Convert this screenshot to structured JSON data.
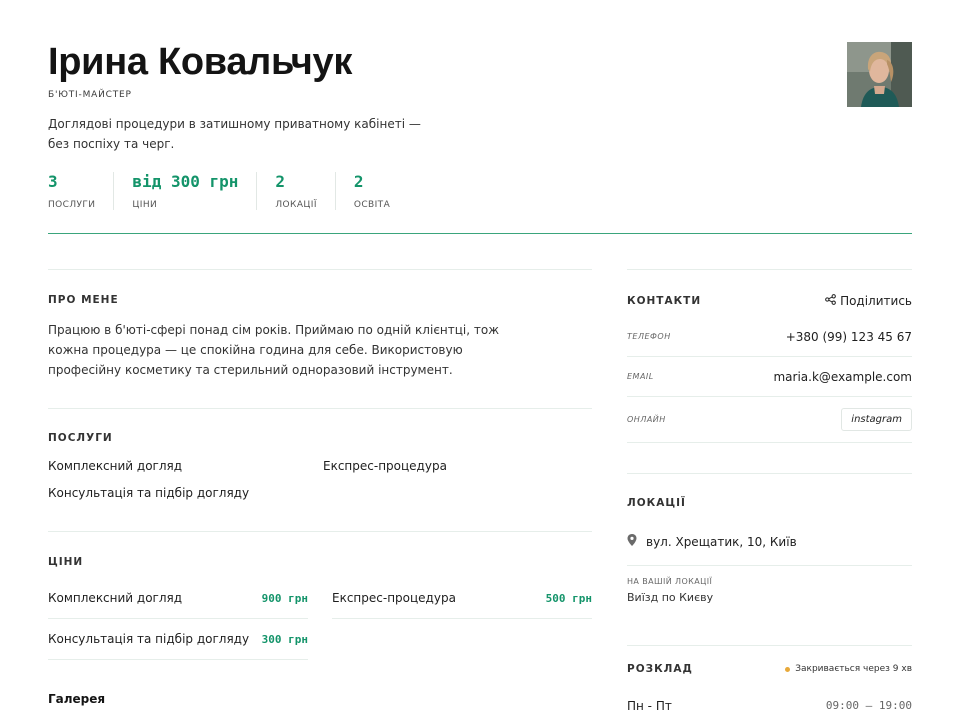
{
  "profile": {
    "name": "Ірина Ковальчук",
    "role": "Б'ЮТІ-МАЙСТЕР",
    "tagline": "Доглядові процедури в затишному приватному кабінеті — без поспіху та черг."
  },
  "stats": [
    {
      "value": "3",
      "label": "ПОСЛУГИ"
    },
    {
      "value": "від 300 грн",
      "label": "ЦІНИ"
    },
    {
      "value": "2",
      "label": "ЛОКАЦІЇ"
    },
    {
      "value": "2",
      "label": "ОСВІТА"
    }
  ],
  "about": {
    "title": "ПРО МЕНЕ",
    "text": "Працюю в б'юті-сфері понад сім років. Приймаю по одній клієнтці, тож кожна процедура — це спокійна година для себе. Використовую професійну косметику та стерильний одноразовий інструмент."
  },
  "services": {
    "title": "ПОСЛУГИ",
    "items": [
      "Комплексний догляд",
      "Експрес-процедура",
      "Консультація та підбір догляду"
    ]
  },
  "prices": {
    "title": "ЦІНИ",
    "items": [
      {
        "name": "Комплексний догляд",
        "price": "900 грн"
      },
      {
        "name": "Експрес-процедура",
        "price": "500 грн"
      },
      {
        "name": "Консультація та підбір догляду",
        "price": "300 грн"
      }
    ]
  },
  "gallery": {
    "title": "Галерея"
  },
  "contacts": {
    "title": "КОНТАКТИ",
    "share_label": "Поділитись",
    "phone_label": "ТЕЛЕФОН",
    "phone": "+380 (99) 123 45 67",
    "email_label": "EMAIL",
    "email": "maria.k@example.com",
    "online_label": "ОНЛАЙН",
    "instagram": "instagram"
  },
  "locations": {
    "title": "ЛОКАЦІЇ",
    "address": "вул. Хрещатик, 10, Київ",
    "onsite_label": "НА ВАШІЙ ЛОКАЦІЇ",
    "onsite_value": "Виїзд по Києву"
  },
  "schedule": {
    "title": "РОЗКЛАД",
    "status": "Закривається через 9 хв",
    "status_color": "#e8a93a",
    "rows": [
      {
        "days": "Пн - Пт",
        "hours": "09:00 — 19:00"
      }
    ]
  },
  "colors": {
    "accent": "#14946a",
    "divider": "#3aa57c"
  }
}
